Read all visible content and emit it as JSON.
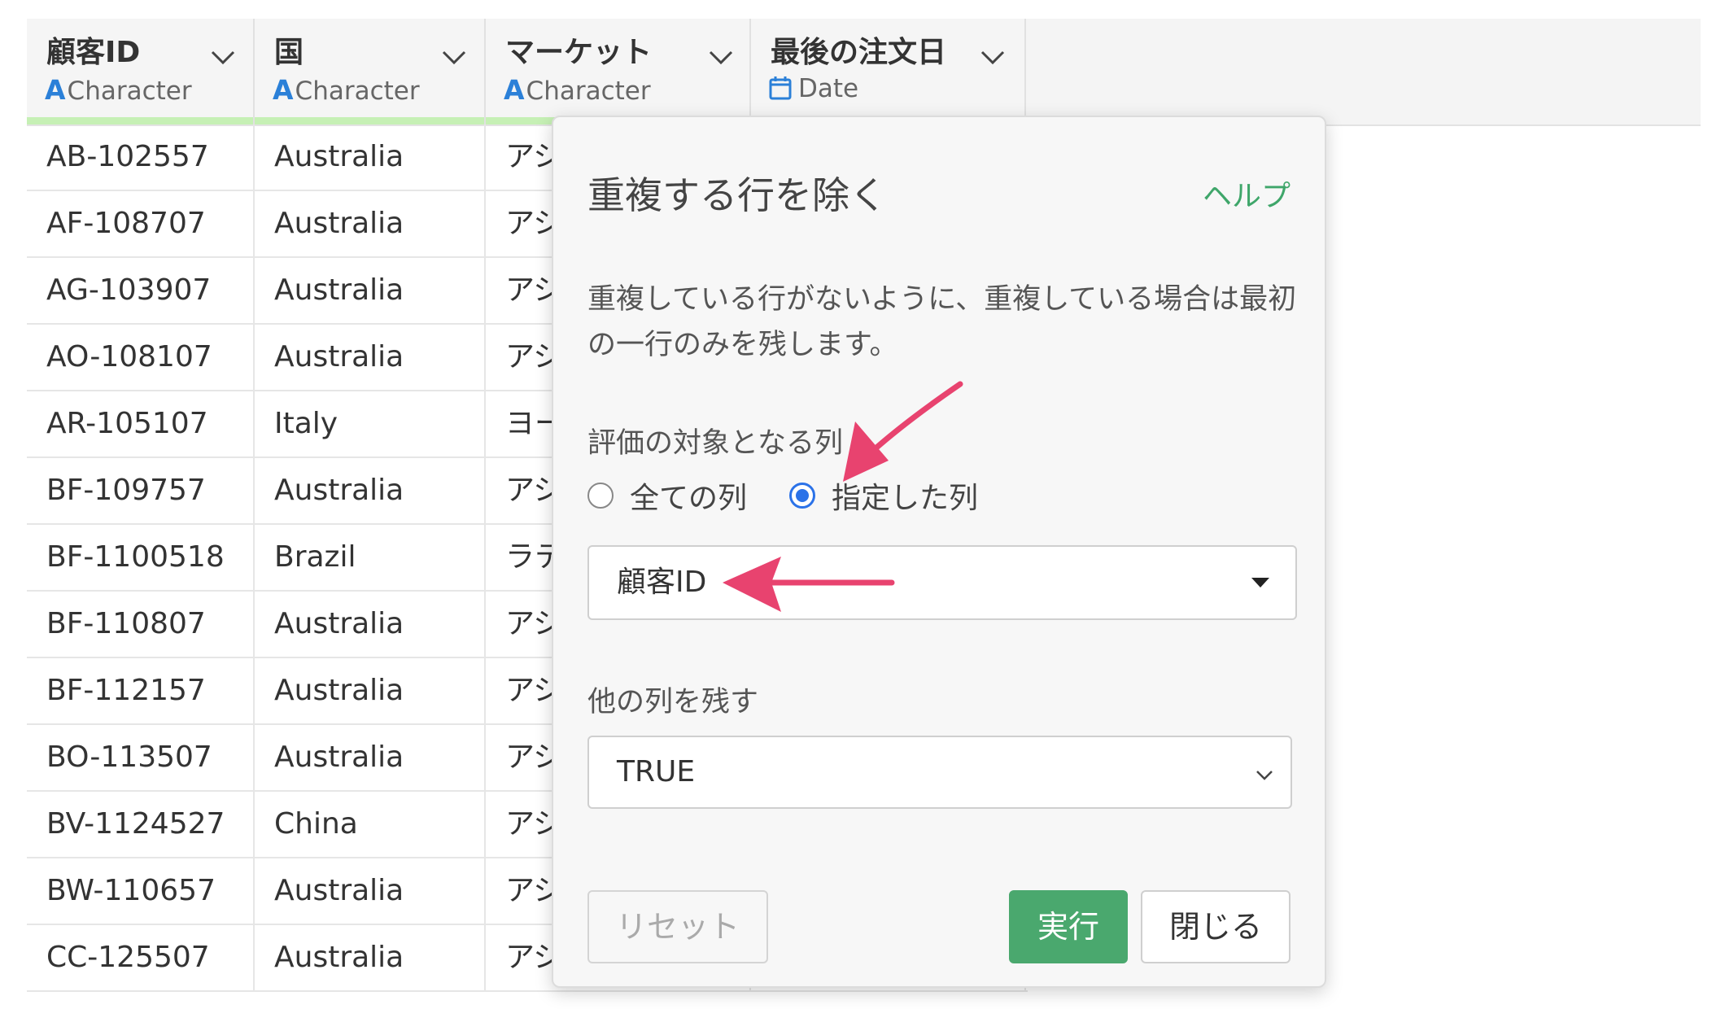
{
  "columns": [
    {
      "name": "顧客ID",
      "type": "Character",
      "type_icon": "A"
    },
    {
      "name": "国",
      "type": "Character",
      "type_icon": "A"
    },
    {
      "name": "マーケット",
      "type": "Character",
      "type_icon": "A"
    },
    {
      "name": "最後の注文日",
      "type": "Date",
      "type_icon": "calendar-icon"
    }
  ],
  "rows": [
    {
      "id": "AB-102557",
      "country": "Australia",
      "market": "アジ"
    },
    {
      "id": "AF-108707",
      "country": "Australia",
      "market": "アジ"
    },
    {
      "id": "AG-103907",
      "country": "Australia",
      "market": "アジ"
    },
    {
      "id": "AO-108107",
      "country": "Australia",
      "market": "アジ"
    },
    {
      "id": "AR-105107",
      "country": "Italy",
      "market": "ヨー"
    },
    {
      "id": "BF-109757",
      "country": "Australia",
      "market": "アジ"
    },
    {
      "id": "BF-1100518",
      "country": "Brazil",
      "market": "ラテ"
    },
    {
      "id": "BF-110807",
      "country": "Australia",
      "market": "アジ"
    },
    {
      "id": "BF-112157",
      "country": "Australia",
      "market": "アジ"
    },
    {
      "id": "BO-113507",
      "country": "Australia",
      "market": "アジ"
    },
    {
      "id": "BV-1124527",
      "country": "China",
      "market": "アジ"
    },
    {
      "id": "BW-110657",
      "country": "Australia",
      "market": "アジ"
    },
    {
      "id": "CC-125507",
      "country": "Australia",
      "market": "アジ"
    }
  ],
  "dialog": {
    "title": "重複する行を除く",
    "help": "ヘルプ",
    "description": "重複している行がないように、重複している場合は最初の一行のみを残します。",
    "eval_label": "評価の対象となる列",
    "radio_all": "全ての列",
    "radio_selected": "指定した列",
    "radio_checked": "selected",
    "column_select_value": "顧客ID",
    "keep_label": "他の列を残す",
    "keep_select_value": "TRUE",
    "reset": "リセット",
    "run": "実行",
    "close": "閉じる"
  },
  "colors": {
    "accent_green": "#4aa86e",
    "help_green": "#3fa66a",
    "radio_blue": "#2b72e8",
    "annotation_pink": "#e8436f",
    "header_bar": "#c6f0b5"
  }
}
